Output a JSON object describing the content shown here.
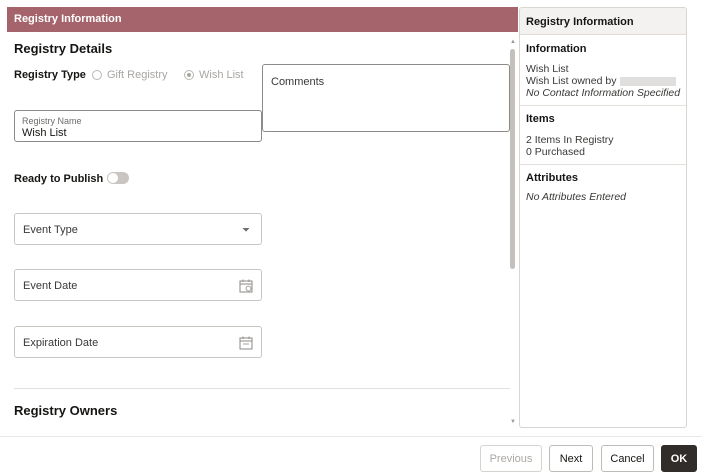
{
  "left": {
    "header": "Registry Information",
    "details_title": "Registry Details",
    "registry_type_label": "Registry Type",
    "registry_type_options": [
      "Gift Registry",
      "Wish List"
    ],
    "registry_type_selected": "Wish List",
    "comments_placeholder": "Comments",
    "registry_name_label": "Registry Name",
    "registry_name_value": "Wish List",
    "ready_to_publish_label": "Ready to Publish",
    "ready_to_publish_on": false,
    "event_type_label": "Event Type",
    "event_date_label": "Event Date",
    "expiration_date_label": "Expiration Date",
    "owners_title": "Registry Owners"
  },
  "right": {
    "header": "Registry Information",
    "information_title": "Information",
    "information_lines": [
      "Wish List",
      "Wish List owned by",
      "No Contact Information Specified"
    ],
    "items_title": "Items",
    "items_lines": [
      "2 Items In Registry",
      "0 Purchased"
    ],
    "attributes_title": "Attributes",
    "attributes_lines": [
      "No Attributes Entered"
    ]
  },
  "footer": {
    "previous": "Previous",
    "next": "Next",
    "cancel": "Cancel",
    "ok": "OK"
  },
  "icons": {
    "event_type": "chevron-down-icon",
    "event_date": "calendar-icon",
    "expiration_date": "calendar-icon"
  },
  "colors": {
    "header_bar": "#a5646c",
    "primary_button": "#312d2a"
  }
}
